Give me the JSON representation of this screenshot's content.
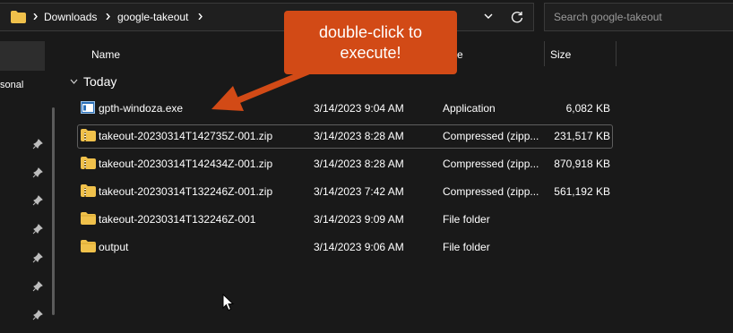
{
  "address": {
    "breadcrumbs": [
      "Downloads",
      "google-takeout"
    ]
  },
  "search": {
    "placeholder": "Search google-takeout"
  },
  "sidebar": {
    "partial_label": "sonal"
  },
  "columns": {
    "name": "Name",
    "type": "e",
    "size": "Size"
  },
  "group": {
    "label": "Today"
  },
  "files": [
    {
      "name": "gpth-windoza.exe",
      "date": "3/14/2023 9:04 AM",
      "type": "Application",
      "size": "6,082 KB",
      "icon": "application-icon"
    },
    {
      "name": "takeout-20230314T142735Z-001.zip",
      "date": "3/14/2023 8:28 AM",
      "type": "Compressed (zipp...",
      "size": "231,517 KB",
      "icon": "zip-folder-icon"
    },
    {
      "name": "takeout-20230314T142434Z-001.zip",
      "date": "3/14/2023 8:28 AM",
      "type": "Compressed (zipp...",
      "size": "870,918 KB",
      "icon": "zip-folder-icon"
    },
    {
      "name": "takeout-20230314T132246Z-001.zip",
      "date": "3/14/2023 7:42 AM",
      "type": "Compressed (zipp...",
      "size": "561,192 KB",
      "icon": "zip-folder-icon"
    },
    {
      "name": "takeout-20230314T132246Z-001",
      "date": "3/14/2023 9:09 AM",
      "type": "File folder",
      "size": "",
      "icon": "folder-icon"
    },
    {
      "name": "output",
      "date": "3/14/2023 9:06 AM",
      "type": "File folder",
      "size": "",
      "icon": "folder-icon"
    }
  ],
  "callout": {
    "line1": "double-click to",
    "line2": "execute!"
  },
  "colors": {
    "callout": "#d24a16",
    "folder": "#f0c14b",
    "background": "#191919"
  }
}
